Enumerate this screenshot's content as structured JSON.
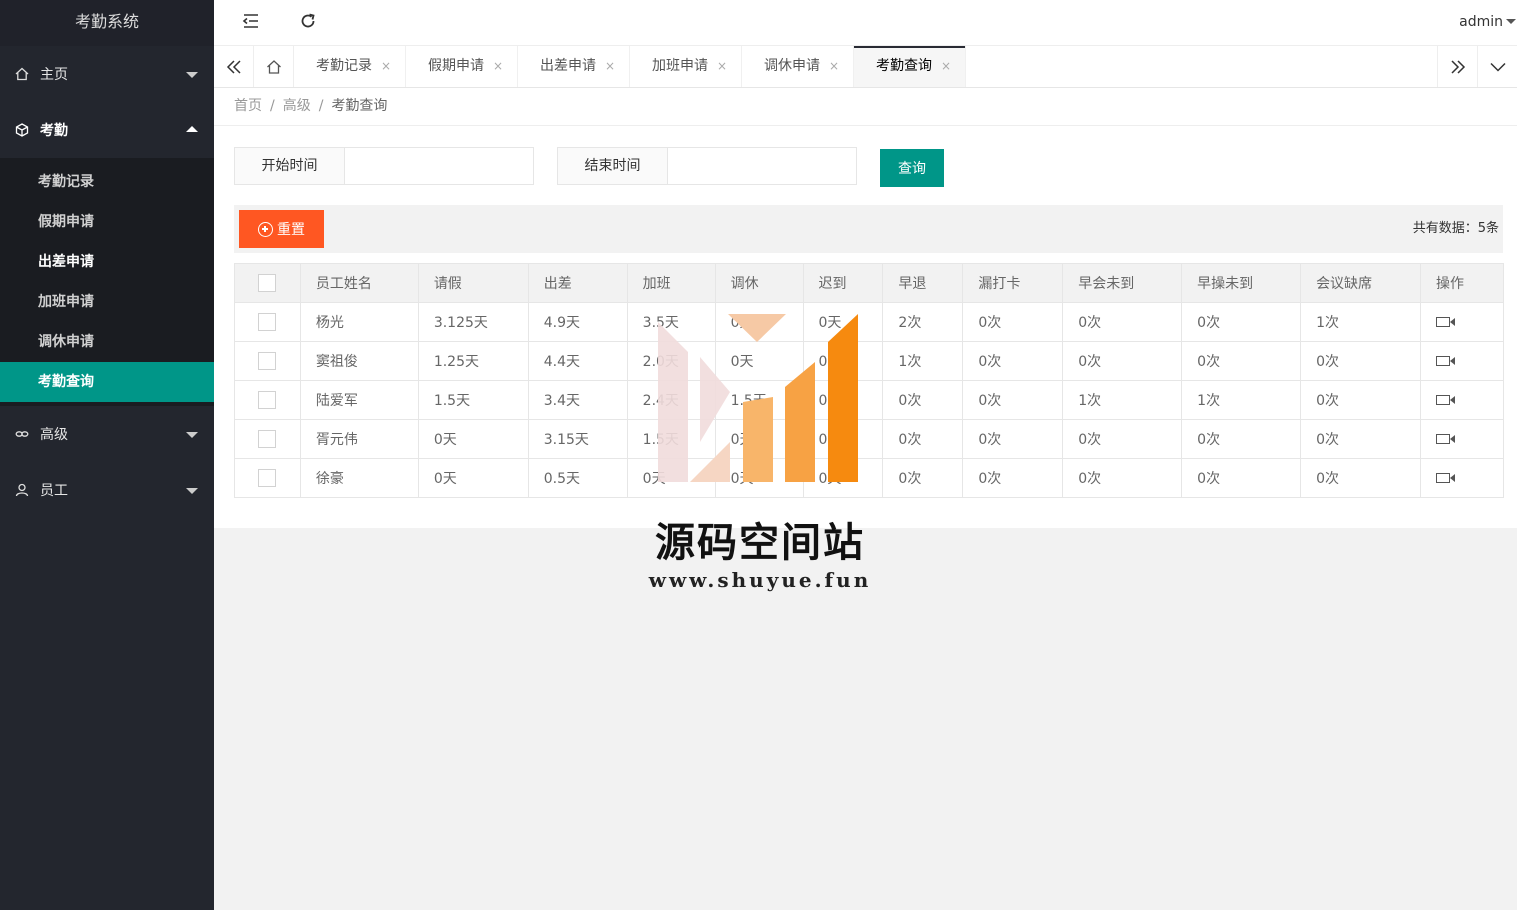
{
  "app": {
    "title": "考勤系统",
    "user": "admin"
  },
  "sidebar": {
    "groups": [
      {
        "label": "主页",
        "icon": "home-icon"
      },
      {
        "label": "考勤",
        "icon": "cube-icon"
      },
      {
        "label": "高级",
        "icon": "link-icon"
      },
      {
        "label": "员工",
        "icon": "user-icon"
      }
    ],
    "sub_items": [
      {
        "label": "考勤记录"
      },
      {
        "label": "假期申请"
      },
      {
        "label": "出差申请"
      },
      {
        "label": "加班申请"
      },
      {
        "label": "调休申请"
      },
      {
        "label": "考勤查询"
      }
    ]
  },
  "tabs": [
    {
      "label": "考勤记录"
    },
    {
      "label": "假期申请"
    },
    {
      "label": "出差申请"
    },
    {
      "label": "加班申请"
    },
    {
      "label": "调休申请"
    },
    {
      "label": "考勤查询"
    }
  ],
  "tab_close": "×",
  "breadcrumb": {
    "items": [
      "首页",
      "高级",
      "考勤查询"
    ],
    "sep": "/"
  },
  "filter": {
    "start_label": "开始时间",
    "start_value": "",
    "end_label": "结束时间",
    "end_value": "",
    "query_button": "查询"
  },
  "toolbar": {
    "reset_button": "重置",
    "total": "共有数据：5条"
  },
  "table": {
    "headers": [
      "员工姓名",
      "请假",
      "出差",
      "加班",
      "调休",
      "迟到",
      "早退",
      "漏打卡",
      "早会未到",
      "早操未到",
      "会议缺席",
      "操作"
    ],
    "rows": [
      [
        "杨光",
        "3.125天",
        "4.9天",
        "3.5天",
        "0天",
        "0天",
        "2次",
        "0次",
        "0次",
        "0次",
        "1次"
      ],
      [
        "窦祖俊",
        "1.25天",
        "4.4天",
        "2.0天",
        "0天",
        "0天",
        "1次",
        "0次",
        "0次",
        "0次",
        "0次"
      ],
      [
        "陆爱军",
        "1.5天",
        "3.4天",
        "2.4天",
        "1.5天",
        "0天",
        "0次",
        "0次",
        "1次",
        "1次",
        "0次"
      ],
      [
        "胥元伟",
        "0天",
        "3.15天",
        "1.5天",
        "0天",
        "0天",
        "0次",
        "0次",
        "0次",
        "0次",
        "0次"
      ],
      [
        "徐豪",
        "0天",
        "0.5天",
        "0天",
        "0天",
        "0天",
        "0次",
        "0次",
        "0次",
        "0次",
        "0次"
      ]
    ]
  },
  "watermark": {
    "title": "源码空间站",
    "url": "www.shuyue.fun"
  },
  "colors": {
    "sidebar_bg": "#23262e",
    "accent": "#009688",
    "reset": "#ff5722"
  }
}
